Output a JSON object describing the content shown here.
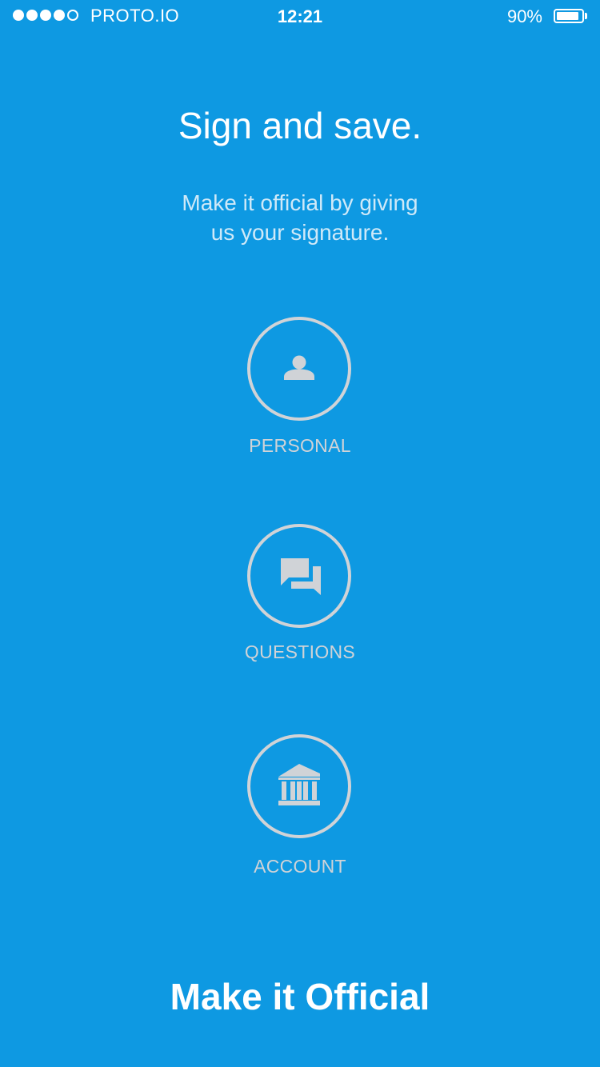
{
  "status_bar": {
    "carrier": "PROTO.IO",
    "time": "12:21",
    "battery_percent": "90%",
    "battery_level": 0.9,
    "signal_bars_filled": 4,
    "signal_bars_total": 5
  },
  "header": {
    "title": "Sign and save.",
    "subtitle": "Make it official by giving\nus your signature."
  },
  "options": [
    {
      "label": "PERSONAL",
      "icon": "person-icon"
    },
    {
      "label": "QUESTIONS",
      "icon": "chat-icon"
    },
    {
      "label": "ACCOUNT",
      "icon": "bank-icon"
    }
  ],
  "cta": {
    "label": "Make it Official"
  },
  "colors": {
    "background": "#0e99e2",
    "icon_gray": "#d0d3d7",
    "text": "#ffffff"
  }
}
